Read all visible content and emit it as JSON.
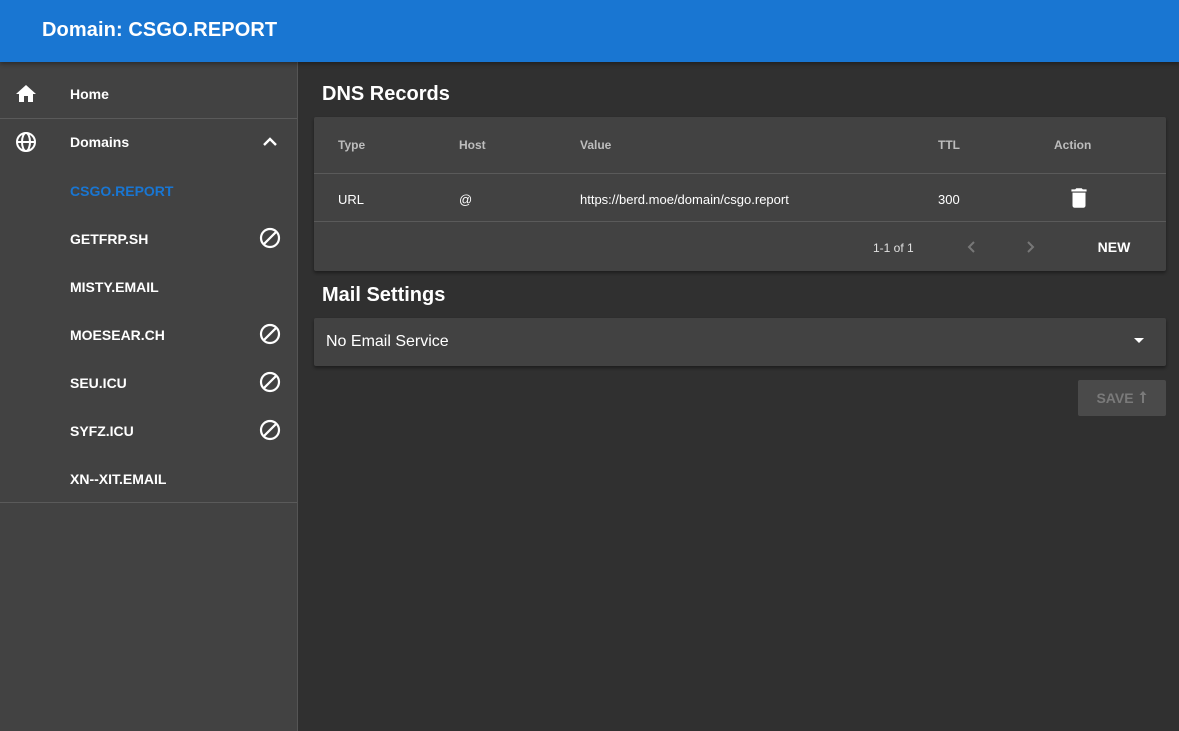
{
  "appbar": {
    "title": "Domain: CSGO.REPORT"
  },
  "sidebar": {
    "home_label": "Home",
    "domains_label": "Domains",
    "domains": [
      {
        "name": "CSGO.REPORT",
        "active": true,
        "blocked": false
      },
      {
        "name": "GETFRP.SH",
        "active": false,
        "blocked": true
      },
      {
        "name": "MISTY.EMAIL",
        "active": false,
        "blocked": false
      },
      {
        "name": "MOESEAR.CH",
        "active": false,
        "blocked": true
      },
      {
        "name": "SEU.ICU",
        "active": false,
        "blocked": true
      },
      {
        "name": "SYFZ.ICU",
        "active": false,
        "blocked": true
      },
      {
        "name": "XN--XIT.EMAIL",
        "active": false,
        "blocked": false
      }
    ]
  },
  "dns": {
    "title": "DNS Records",
    "columns": {
      "type": "Type",
      "host": "Host",
      "value": "Value",
      "ttl": "TTL",
      "action": "Action"
    },
    "rows": [
      {
        "type": "URL",
        "host": "@",
        "value": "https://berd.moe/domain/csgo.report",
        "ttl": "300"
      }
    ],
    "pagination": "1-1 of 1",
    "new_label": "NEW"
  },
  "mail": {
    "title": "Mail Settings",
    "selected": "No Email Service",
    "save_label": "SAVE"
  },
  "colors": {
    "appbar": "#1976d2",
    "active_link": "#1976d2",
    "sidebar_bg": "#424242",
    "main_bg": "#303030"
  }
}
